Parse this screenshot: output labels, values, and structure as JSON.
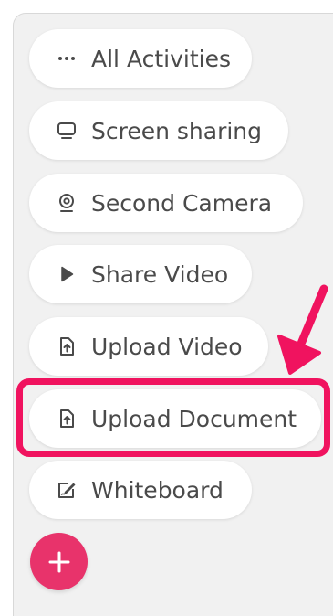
{
  "activities": [
    {
      "label": "All Activities",
      "icon": "more-dots-icon"
    },
    {
      "label": "Screen sharing",
      "icon": "monitor-icon"
    },
    {
      "label": "Second Camera",
      "icon": "webcam-icon"
    },
    {
      "label": "Share Video",
      "icon": "play-icon"
    },
    {
      "label": "Upload Video",
      "icon": "upload-file-icon"
    },
    {
      "label": "Upload Document",
      "icon": "upload-file-icon"
    },
    {
      "label": "Whiteboard",
      "icon": "whiteboard-icon"
    }
  ],
  "highlighted_item": "Upload Document",
  "colors": {
    "accent": "#f0135f",
    "fab": "#e8336b",
    "panel": "#f1f1f1",
    "text": "#4a4a4a"
  },
  "fab_icon": "plus-icon"
}
